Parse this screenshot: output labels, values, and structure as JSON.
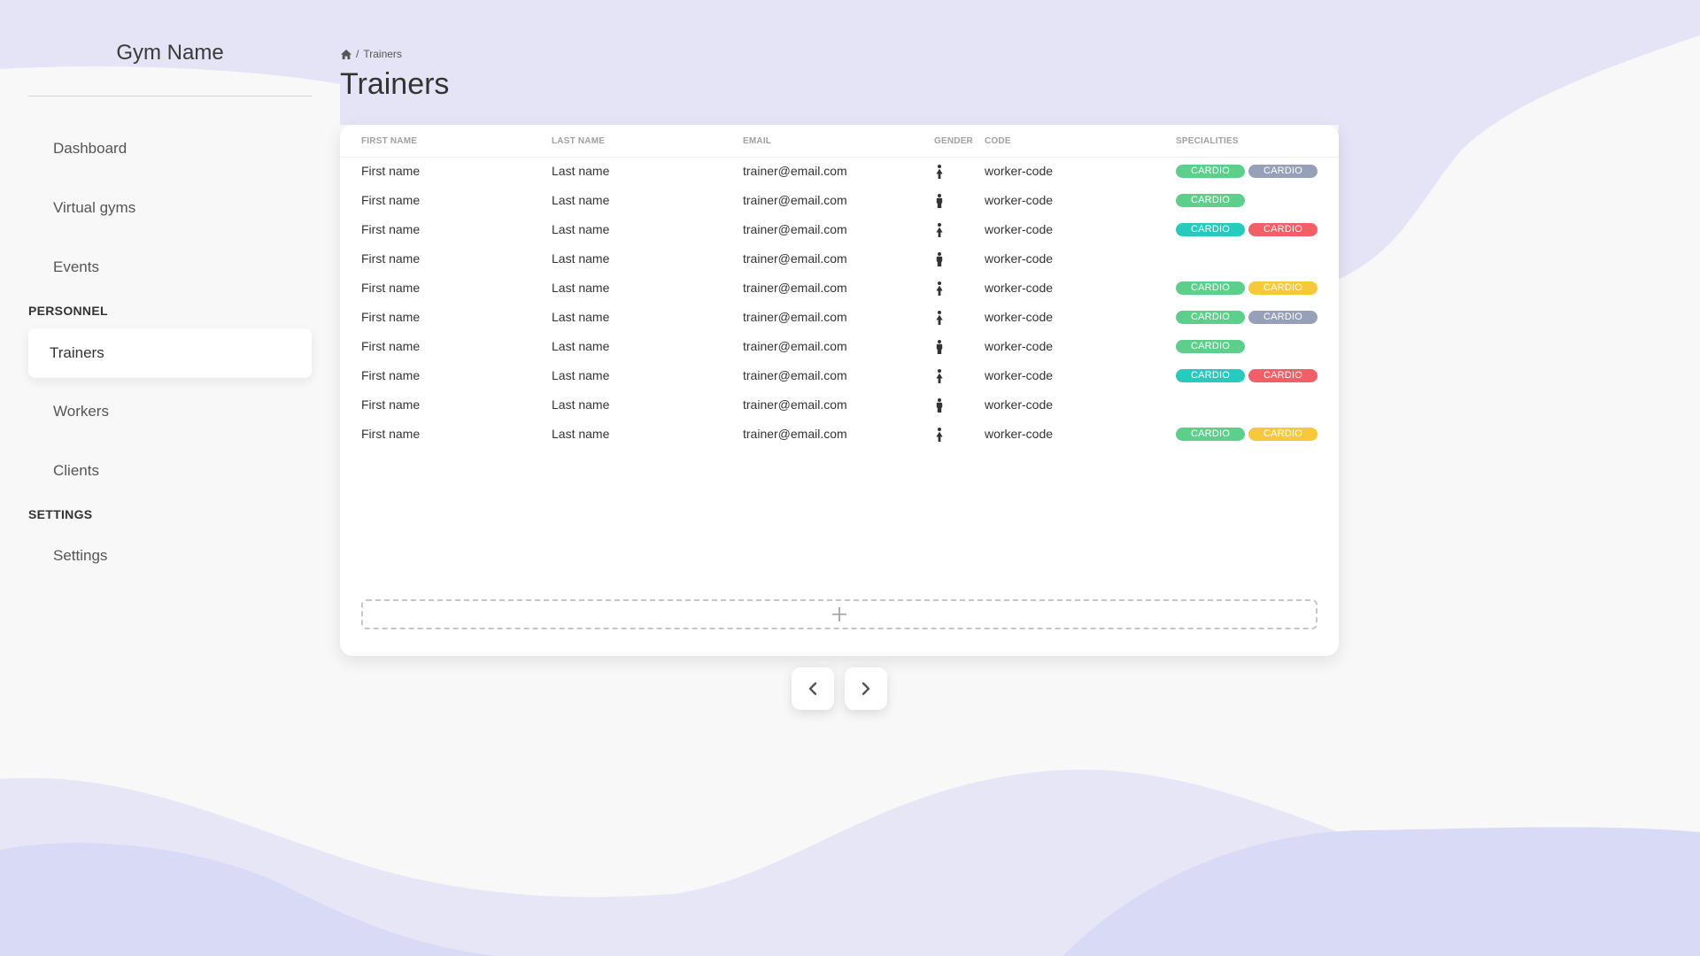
{
  "sidebar": {
    "brand": "Gym Name",
    "items": [
      {
        "label": "Dashboard"
      },
      {
        "label": "Virtual gyms"
      },
      {
        "label": "Events"
      },
      {
        "section": "PERSONNEL"
      },
      {
        "label": "Trainers",
        "active": true
      },
      {
        "label": "Workers"
      },
      {
        "label": "Clients"
      },
      {
        "section": "SETTINGS"
      },
      {
        "label": "Settings"
      }
    ]
  },
  "breadcrumb": {
    "home_icon": "home-icon",
    "separator": "/",
    "current": "Trainers"
  },
  "page": {
    "title": "Trainers"
  },
  "table": {
    "columns": [
      "FIRST NAME",
      "LAST NAME",
      "EMAIL",
      "GENDER",
      "CODE",
      "SPECIALITIES"
    ],
    "rows": [
      {
        "first": "First name",
        "last": "Last name",
        "email": "trainer@email.com",
        "gender": "female",
        "code": "worker-code",
        "specialities": [
          {
            "label": "CARDIO",
            "color": "#5ccf8b"
          },
          {
            "label": "CARDIO",
            "color": "#96a0b9"
          }
        ]
      },
      {
        "first": "First name",
        "last": "Last name",
        "email": "trainer@email.com",
        "gender": "male",
        "code": "worker-code",
        "specialities": [
          {
            "label": "CARDIO",
            "color": "#5ccf8b"
          }
        ]
      },
      {
        "first": "First name",
        "last": "Last name",
        "email": "trainer@email.com",
        "gender": "female",
        "code": "worker-code",
        "specialities": [
          {
            "label": "CARDIO",
            "color": "#27cbbd"
          },
          {
            "label": "CARDIO",
            "color": "#f25f66"
          }
        ]
      },
      {
        "first": "First name",
        "last": "Last name",
        "email": "trainer@email.com",
        "gender": "male",
        "code": "worker-code",
        "specialities": []
      },
      {
        "first": "First name",
        "last": "Last name",
        "email": "trainer@email.com",
        "gender": "female",
        "code": "worker-code",
        "specialities": [
          {
            "label": "CARDIO",
            "color": "#5ccf8b"
          },
          {
            "label": "CARDIO",
            "color": "#f7c93a"
          }
        ]
      },
      {
        "first": "First name",
        "last": "Last name",
        "email": "trainer@email.com",
        "gender": "female",
        "code": "worker-code",
        "specialities": [
          {
            "label": "CARDIO",
            "color": "#5ccf8b"
          },
          {
            "label": "CARDIO",
            "color": "#96a0b9"
          }
        ]
      },
      {
        "first": "First name",
        "last": "Last name",
        "email": "trainer@email.com",
        "gender": "male",
        "code": "worker-code",
        "specialities": [
          {
            "label": "CARDIO",
            "color": "#5ccf8b"
          }
        ]
      },
      {
        "first": "First name",
        "last": "Last name",
        "email": "trainer@email.com",
        "gender": "female",
        "code": "worker-code",
        "specialities": [
          {
            "label": "CARDIO",
            "color": "#27cbbd"
          },
          {
            "label": "CARDIO",
            "color": "#f25f66"
          }
        ]
      },
      {
        "first": "First name",
        "last": "Last name",
        "email": "trainer@email.com",
        "gender": "male",
        "code": "worker-code",
        "specialities": []
      },
      {
        "first": "First name",
        "last": "Last name",
        "email": "trainer@email.com",
        "gender": "female",
        "code": "worker-code",
        "specialities": [
          {
            "label": "CARDIO",
            "color": "#5ccf8b"
          },
          {
            "label": "CARDIO",
            "color": "#f7c93a"
          }
        ]
      }
    ],
    "add_icon": "plus-icon"
  },
  "pagination": {
    "prev_icon": "chevron-left-icon",
    "next_icon": "chevron-right-icon"
  },
  "theme": {
    "background": "#f8f8f8",
    "wave_color": "#e4e4f6",
    "wave_color_deep": "#d9daf6"
  }
}
